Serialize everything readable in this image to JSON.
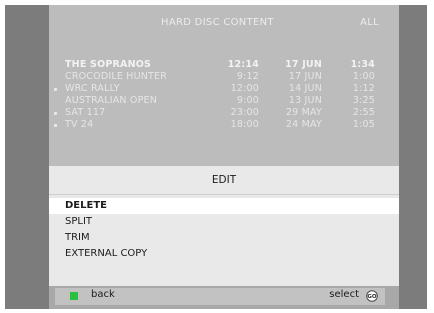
{
  "header": {
    "title": "HARD DISC CONTENT",
    "filter": "ALL"
  },
  "recordings": [
    {
      "name": "THE  SOPRANOS",
      "time": "12:14",
      "date": "17  JUN",
      "duration": "1:34",
      "bullet": false,
      "bold": true
    },
    {
      "name": "CROCODILE  HUNTER",
      "time": "9:12",
      "date": "17  JUN",
      "duration": "1:00",
      "bullet": false,
      "bold": false
    },
    {
      "name": "WRC  RALLY",
      "time": "12:00",
      "date": "14  JUN",
      "duration": "1:12",
      "bullet": true,
      "bold": false
    },
    {
      "name": "AUSTRALIAN  OPEN",
      "time": "9:00",
      "date": "13  JUN",
      "duration": "3:25",
      "bullet": false,
      "bold": false
    },
    {
      "name": "SAT  117",
      "time": "23:00",
      "date": "29  MAY",
      "duration": "2:55",
      "bullet": true,
      "bold": false
    },
    {
      "name": "TV  24",
      "time": "18:00",
      "date": "24  MAY",
      "duration": "1:05",
      "bullet": true,
      "bold": false
    }
  ],
  "menu": {
    "title": "EDIT",
    "items": [
      {
        "label": "DELETE",
        "selected": true
      },
      {
        "label": "SPLIT",
        "selected": false
      },
      {
        "label": "TRIM",
        "selected": false
      },
      {
        "label": "EXTERNAL  COPY",
        "selected": false
      }
    ]
  },
  "footer": {
    "back_label": "back",
    "select_label": "select",
    "go_icon_text": "GO",
    "back_color": "#2bbf3f"
  }
}
